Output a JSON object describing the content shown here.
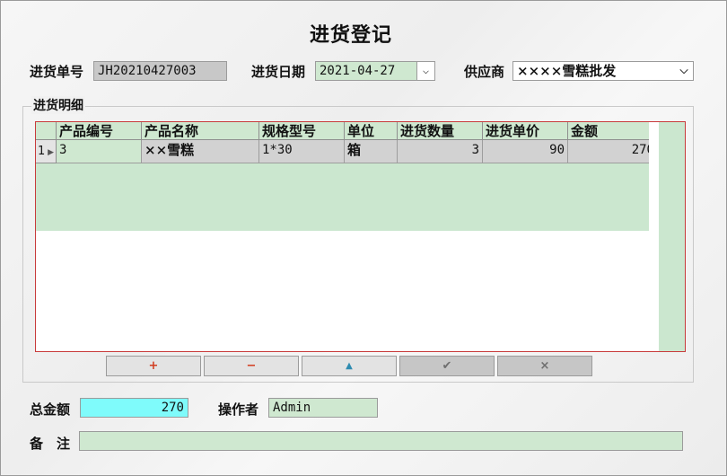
{
  "window": {
    "title": "进货登记"
  },
  "form": {
    "order_no_label": "进货单号",
    "order_no": "JH20210427003",
    "date_label": "进货日期",
    "date": "2021-04-27",
    "supplier_label": "供应商",
    "supplier": "××××雪糕批发",
    "total_label": "总金额",
    "total": "270",
    "operator_label": "操作者",
    "operator": "Admin",
    "remark_label": "备　注",
    "remark": ""
  },
  "detail": {
    "group_label": "进货明细",
    "columns": [
      "产品编号",
      "产品名称",
      "规格型号",
      "单位",
      "进货数量",
      "进货单价",
      "金额"
    ],
    "rows": [
      {
        "row_no": "1",
        "code": "3",
        "name": "××雪糕",
        "spec": "1*30",
        "unit": "箱",
        "qty": "3",
        "price": "90",
        "amount": "270"
      }
    ]
  },
  "navigator": {
    "insert": "+",
    "delete": "−",
    "edit": "▲",
    "post": "✔",
    "cancel": "×"
  },
  "colors": {
    "field_green": "#cfe8d0",
    "total_cyan": "#7ffbfb",
    "grid_border": "#c83b3b"
  }
}
